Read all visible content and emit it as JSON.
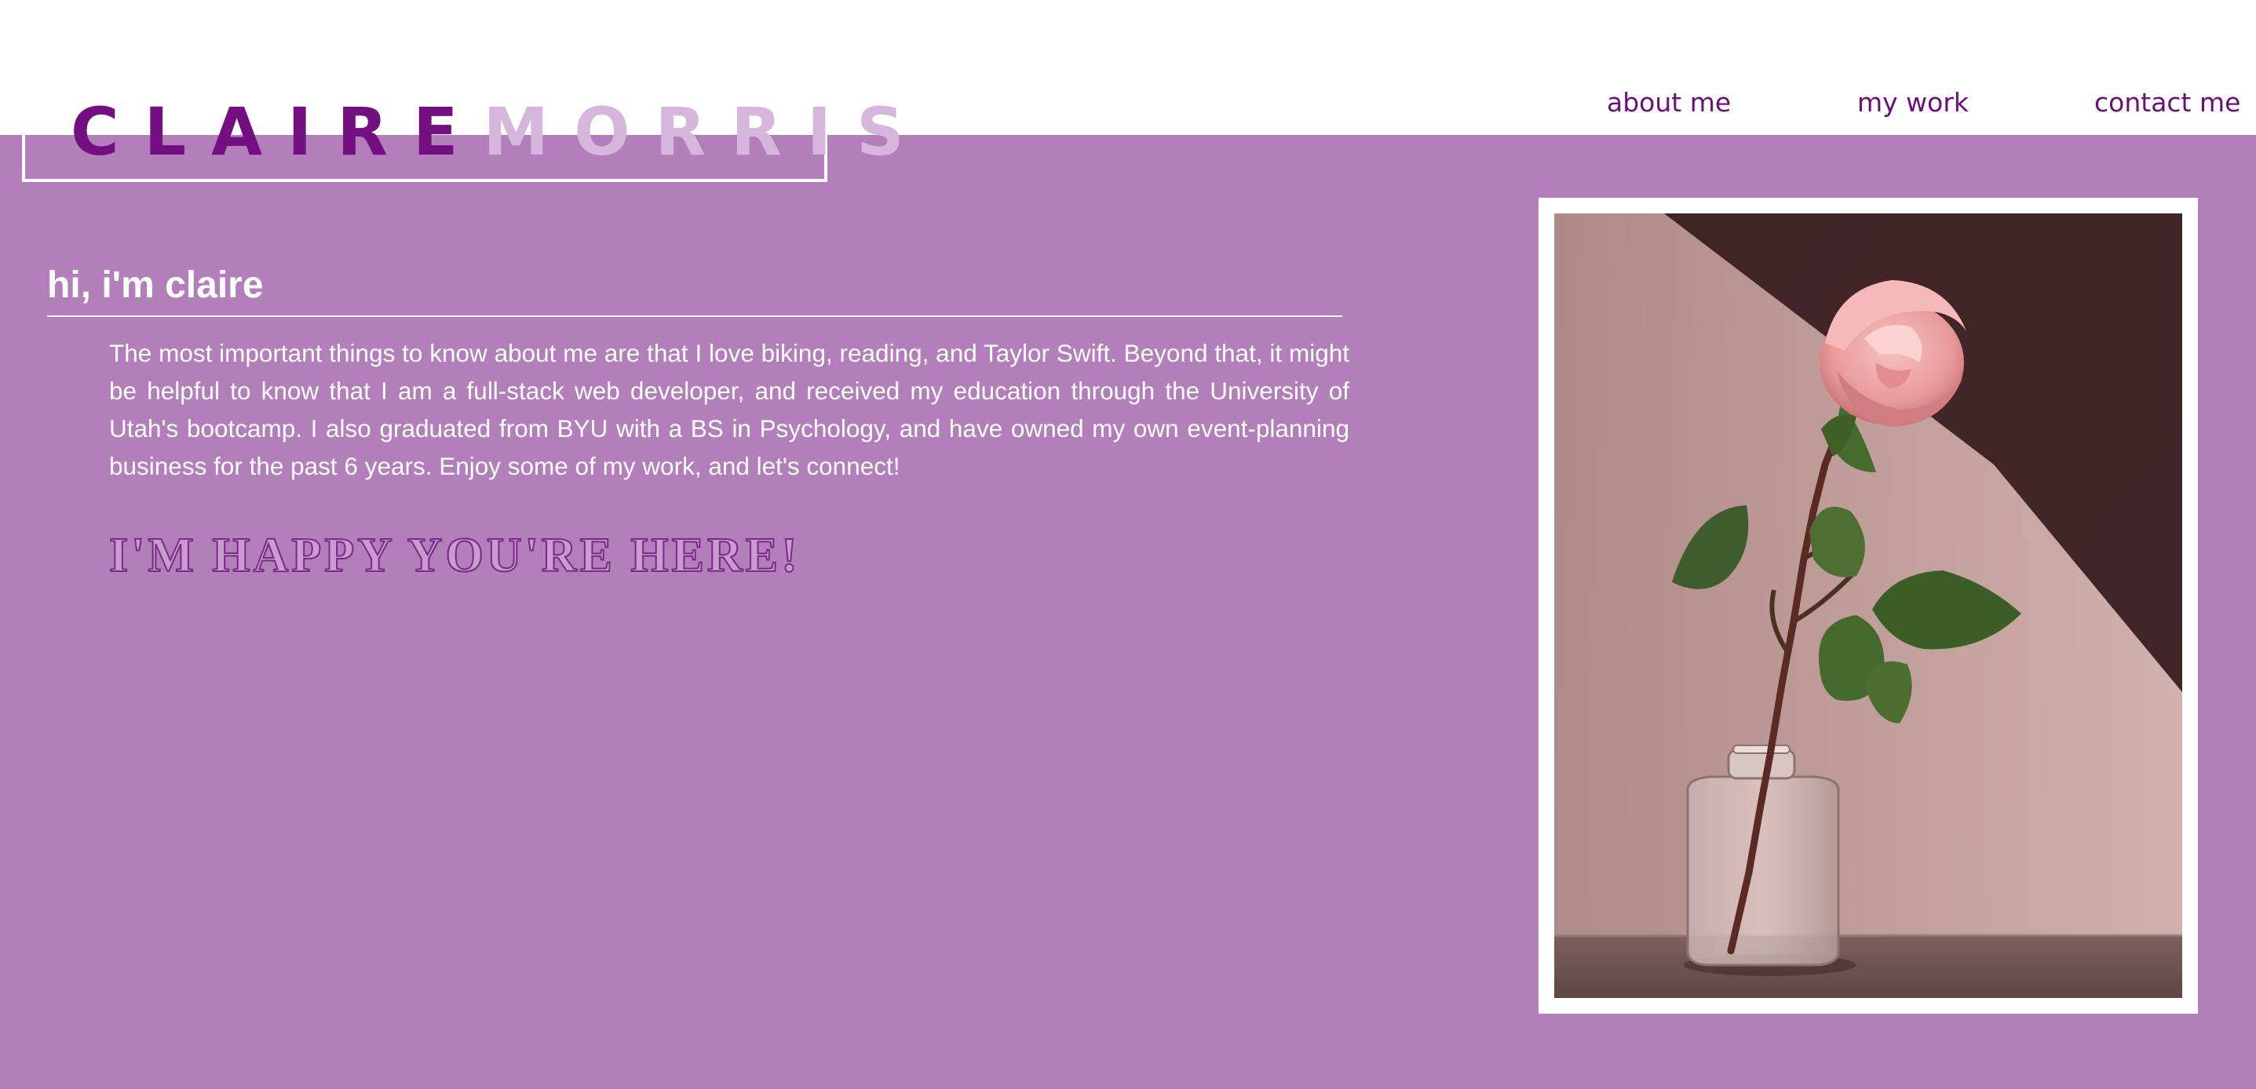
{
  "header": {
    "logo_first": "CLAIRE",
    "logo_last": "MORRIS",
    "nav": {
      "about": "about me",
      "work": "my work",
      "contact": "contact me"
    }
  },
  "main": {
    "greeting": "hi, i'm claire",
    "bio": "The most important things to know about me are that I love biking, reading, and Taylor Swift. Beyond that, it might be helpful to know that I am a full-stack web developer, and received my education through the University of Utah's bootcamp. I also graduated from BYU with a BS in Psychology, and have owned my own event-planning business for the past 6 years. Enjoy some of my work, and let's connect!",
    "tagline": "I'M HAPPY YOU'RE HERE!"
  },
  "colors": {
    "background": "#b27fba",
    "logo_first": "#740f82",
    "logo_last": "#d6b6dc",
    "nav": "#6a0f78",
    "text": "#ffffff"
  }
}
